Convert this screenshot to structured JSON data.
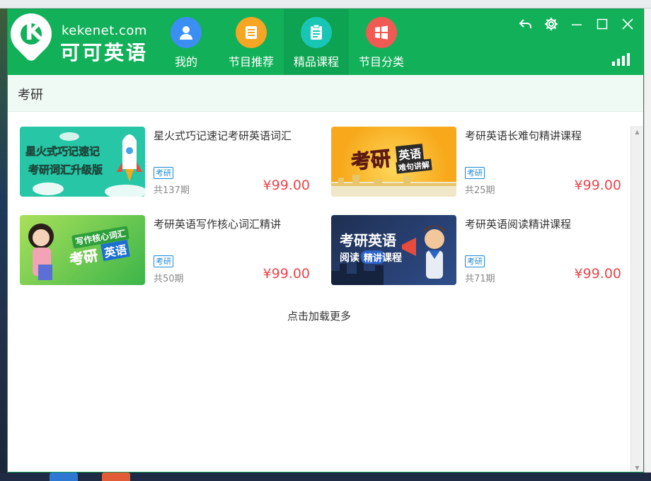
{
  "window": {
    "logo": {
      "domain": "kekenet.com",
      "name": "可可英语",
      "mark": "K"
    },
    "nav": [
      {
        "label": "我的",
        "icon": "user-icon",
        "color": "#3b8ff2"
      },
      {
        "label": "节目推荐",
        "icon": "list-icon",
        "color": "#f6a623"
      },
      {
        "label": "精品课程",
        "icon": "clipboard-icon",
        "color": "#19c6b6",
        "active": true
      },
      {
        "label": "节目分类",
        "icon": "windows-icon",
        "color": "#ef5b52"
      }
    ],
    "controls": [
      "back-icon",
      "gear-icon",
      "minimize-icon",
      "maximize-icon",
      "close-icon"
    ]
  },
  "section": {
    "title": "考研"
  },
  "courses": [
    {
      "title": "星火式巧记速记考研英语词汇",
      "tag": "考研",
      "count": "共137期",
      "price": "¥99.00",
      "thumb_text": [
        "星火式巧记速记",
        "考研词汇升级版"
      ]
    },
    {
      "title": "考研英语长难句精讲课程",
      "tag": "考研",
      "count": "共25期",
      "price": "¥99.00",
      "thumb_text": [
        "考研",
        "英语",
        "难句讲解"
      ]
    },
    {
      "title": "考研英语写作核心词汇精讲",
      "tag": "考研",
      "count": "共50期",
      "price": "¥99.00",
      "thumb_text": [
        "写作核心词汇",
        "考研",
        "英语"
      ]
    },
    {
      "title": "考研英语阅读精讲课程",
      "tag": "考研",
      "count": "共71期",
      "price": "¥99.00",
      "thumb_text": [
        "考研英语",
        "阅读",
        "精讲",
        "课程"
      ]
    }
  ],
  "load_more": "点击加载更多",
  "colors": {
    "brand_green": "#13b05a",
    "price_red": "#e9474b",
    "tag_blue": "#1a88d6"
  }
}
